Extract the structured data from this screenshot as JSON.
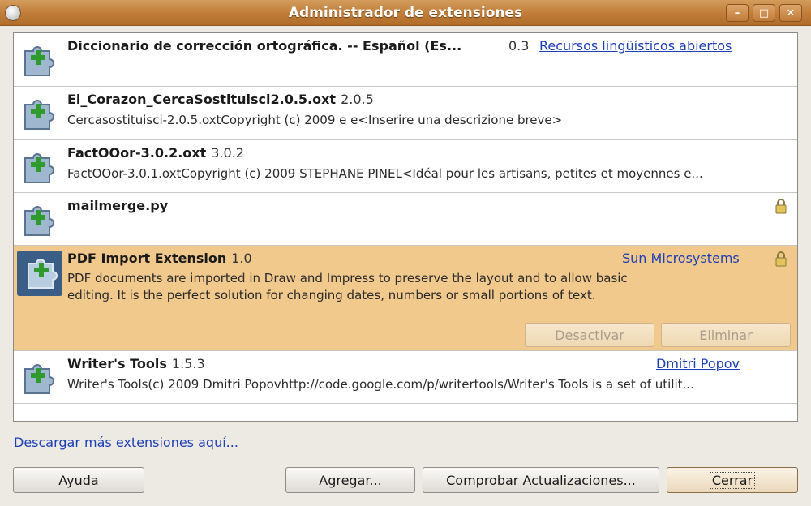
{
  "window": {
    "title": "Administrador de extensiones",
    "controls": {
      "minimize": "–",
      "maximize": "□",
      "close": "✕"
    }
  },
  "extensions": [
    {
      "name": "Diccionario de corrección ortográfica. -- Español (Es...",
      "version": "0.3",
      "publisher": "Recursos lingüísticos abiertos",
      "description": ""
    },
    {
      "name": "El_Corazon_CercaSostituisci2.0.5.oxt",
      "version": "2.0.5",
      "publisher": "",
      "description": "Cercasostituisci-2.0.5.oxtCopyright (c) 2009 e e<Inserire una descrizione breve>"
    },
    {
      "name": "FactOOor-3.0.2.oxt",
      "version": "3.0.2",
      "publisher": "",
      "description": "FactOOor-3.0.1.oxtCopyright (c) 2009 STEPHANE PINEL<Idéal pour les artisans, petites et moyennes e..."
    },
    {
      "name": "mailmerge.py",
      "version": "",
      "publisher": "",
      "description": "",
      "locked": true
    },
    {
      "name": "PDF Import Extension",
      "version": "1.0",
      "publisher": "Sun Microsystems",
      "description": "PDF documents are imported in Draw and Impress to preserve the layout and to allow basic editing. It is the perfect solution for changing dates, numbers or small portions of text.",
      "locked": true,
      "selected": true,
      "buttons": {
        "disable": "Desactivar",
        "remove": "Eliminar"
      }
    },
    {
      "name": "Writer's Tools",
      "version": "1.5.3",
      "publisher": "Dmitri Popov",
      "description": "Writer's Tools(c) 2009 Dmitri Popovhttp://code.google.com/p/writertools/Writer's Tools is a set of utilit..."
    }
  ],
  "more_link": "Descargar más extensiones aquí...",
  "footer": {
    "help": "Ayuda",
    "add": "Agregar...",
    "check_updates": "Comprobar Actualizaciones...",
    "close": "Cerrar"
  },
  "colors": {
    "titlebar": "#c07c38",
    "selected_row": "#f1c98c",
    "link": "#1d3fb5"
  },
  "icons": {
    "extension": "puzzle-piece-plus-icon",
    "lock": "lock-icon"
  }
}
